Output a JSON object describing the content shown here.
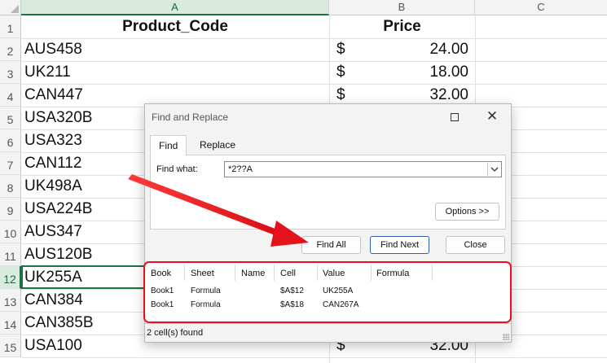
{
  "sheet": {
    "columns": [
      "A",
      "B",
      "C"
    ],
    "row_numbers": [
      "1",
      "2",
      "3",
      "4",
      "5",
      "6",
      "7",
      "8",
      "9",
      "10",
      "11",
      "12",
      "13",
      "14",
      "15"
    ],
    "active_row": "12",
    "header": {
      "product_code": "Product_Code",
      "price": "Price"
    },
    "currency_symbol": "$",
    "rows": [
      {
        "code": "AUS458",
        "price": "24.00"
      },
      {
        "code": "UK211",
        "price": "18.00"
      },
      {
        "code": "CAN447",
        "price": "32.00"
      },
      {
        "code": "USA320B",
        "price": ""
      },
      {
        "code": "USA323",
        "price": ""
      },
      {
        "code": "CAN112",
        "price": ""
      },
      {
        "code": "UK498A",
        "price": ""
      },
      {
        "code": "USA224B",
        "price": ""
      },
      {
        "code": "AUS347",
        "price": ""
      },
      {
        "code": "AUS120B",
        "price": ""
      },
      {
        "code": "UK255A",
        "price": ""
      },
      {
        "code": "CAN384",
        "price": ""
      },
      {
        "code": "CAN385B",
        "price": ""
      },
      {
        "code": "USA100",
        "price": "32.00"
      }
    ]
  },
  "dialog": {
    "title": "Find and Replace",
    "tabs": {
      "find": "Find",
      "replace": "Replace"
    },
    "find_what_label": "Find what:",
    "find_what_value": "*2??A",
    "buttons": {
      "options": "Options >>",
      "find_all": "Find All",
      "find_next": "Find Next",
      "close": "Close"
    },
    "results": {
      "headers": {
        "book": "Book",
        "sheet": "Sheet",
        "name": "Name",
        "cell": "Cell",
        "value": "Value",
        "formula": "Formula"
      },
      "rows": [
        {
          "book": "Book1",
          "sheet": "Formula",
          "name": "",
          "cell": "$A$12",
          "value": "UK255A",
          "formula": ""
        },
        {
          "book": "Book1",
          "sheet": "Formula",
          "name": "",
          "cell": "$A$18",
          "value": "CAN267A",
          "formula": ""
        }
      ]
    },
    "status": "2 cell(s) found"
  },
  "annotation": {
    "color": "#e3121b"
  },
  "icons": {
    "maximize": "maximize-icon",
    "close": "close-icon",
    "dropdown": "chevron-down-icon",
    "resize": "resize-grip-icon",
    "select_all": "select-all-triangle-icon"
  }
}
